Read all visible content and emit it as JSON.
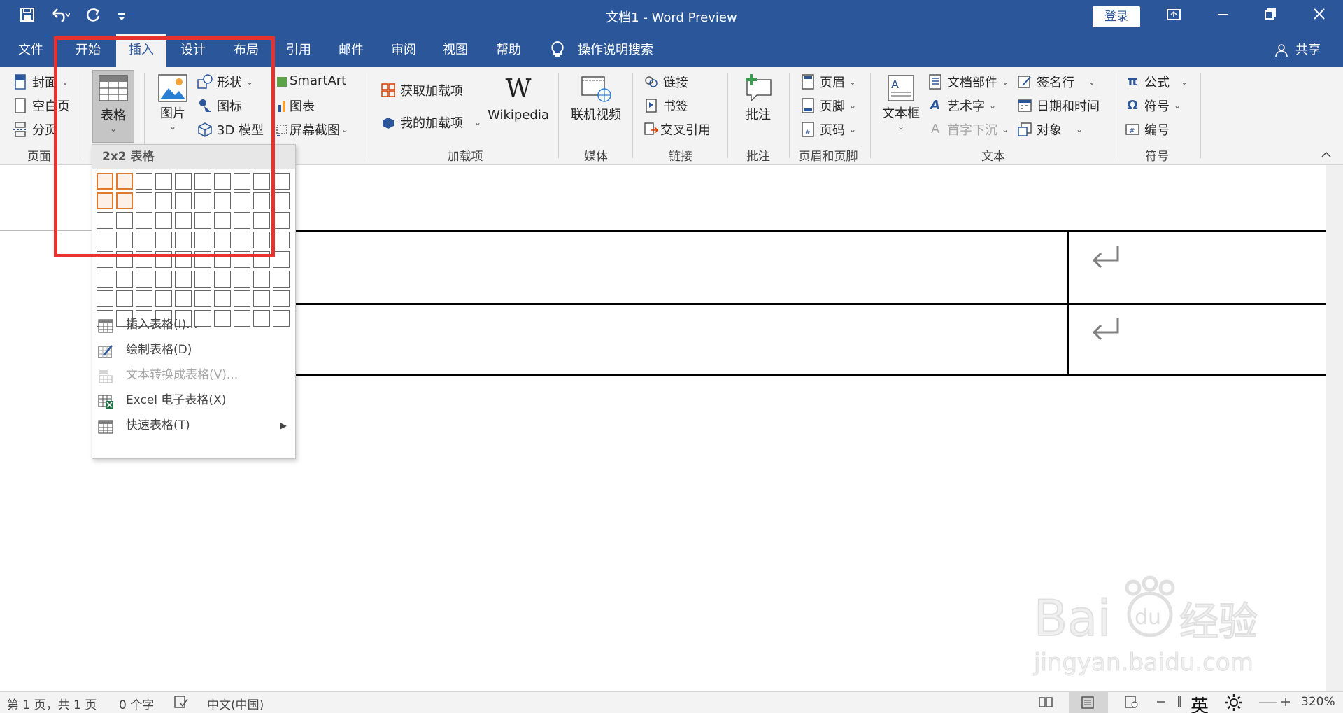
{
  "app": {
    "title": "文档1  -  Word Preview",
    "login_label": "登录"
  },
  "qat": {
    "icons": [
      "save-icon",
      "undo-icon",
      "redo-icon",
      "customize-icon"
    ]
  },
  "tabs": [
    {
      "label": "文件"
    },
    {
      "label": "开始"
    },
    {
      "label": "插入"
    },
    {
      "label": "设计"
    },
    {
      "label": "布局"
    },
    {
      "label": "引用"
    },
    {
      "label": "邮件"
    },
    {
      "label": "审阅"
    },
    {
      "label": "视图"
    },
    {
      "label": "帮助"
    }
  ],
  "active_tab": "插入",
  "tell_me": "操作说明搜索",
  "share": "共享",
  "ribbon": {
    "pages": {
      "cover": "封面",
      "blank": "空白页",
      "break": "分页",
      "label": "页面"
    },
    "table": {
      "label": "表格"
    },
    "illustrations": {
      "picture": "图片",
      "shapes": "形状",
      "icons": "图标",
      "model3d": "3D 模型",
      "smartart": "SmartArt",
      "chart": "图表",
      "screenshot": "屏幕截图"
    },
    "addins": {
      "get": "获取加载项",
      "my": "我的加载项",
      "wikipedia": "Wikipedia",
      "label": "加载项"
    },
    "media": {
      "video": "联机视频",
      "label": "媒体"
    },
    "links": {
      "link": "链接",
      "bookmark": "书签",
      "crossref": "交叉引用",
      "label": "链接"
    },
    "comments": {
      "comment": "批注",
      "label": "批注"
    },
    "headerfooter": {
      "header": "页眉",
      "footer": "页脚",
      "pagenum": "页码",
      "label": "页眉和页脚"
    },
    "text": {
      "textbox": "文本框",
      "parts": "文档部件",
      "wordart": "艺术字",
      "dropcap": "首字下沉",
      "signature": "签名行",
      "datetime": "日期和时间",
      "object": "对象",
      "label": "文本"
    },
    "symbols": {
      "equation": "公式",
      "symbol": "符号",
      "number": "编号",
      "label": "符号"
    }
  },
  "dropdown": {
    "header": "2x2 表格",
    "grid_cols": 10,
    "grid_rows": 8,
    "highlight_cols": 2,
    "highlight_rows": 2,
    "items": [
      {
        "label": "插入表格(I)...",
        "disabled": false,
        "icon": "insert-table-icon"
      },
      {
        "label": "绘制表格(D)",
        "disabled": false,
        "icon": "draw-table-icon"
      },
      {
        "label": "文本转换成表格(V)...",
        "disabled": true,
        "icon": "convert-text-icon"
      },
      {
        "label": "Excel 电子表格(X)",
        "disabled": false,
        "icon": "excel-icon"
      },
      {
        "label": "快速表格(T)",
        "disabled": false,
        "icon": "quick-table-icon"
      }
    ]
  },
  "status": {
    "page": "第 1 页，共 1 页",
    "words": "0 个字",
    "lang": "中文(中国)",
    "ime": "英",
    "zoom": "320%"
  },
  "watermark": {
    "brand": "Baidu经验",
    "url": "jingyan.baidu.com"
  },
  "colors": {
    "brand": "#2b579a",
    "highlight": "#e07a2e",
    "annotation": "#e8322f"
  }
}
